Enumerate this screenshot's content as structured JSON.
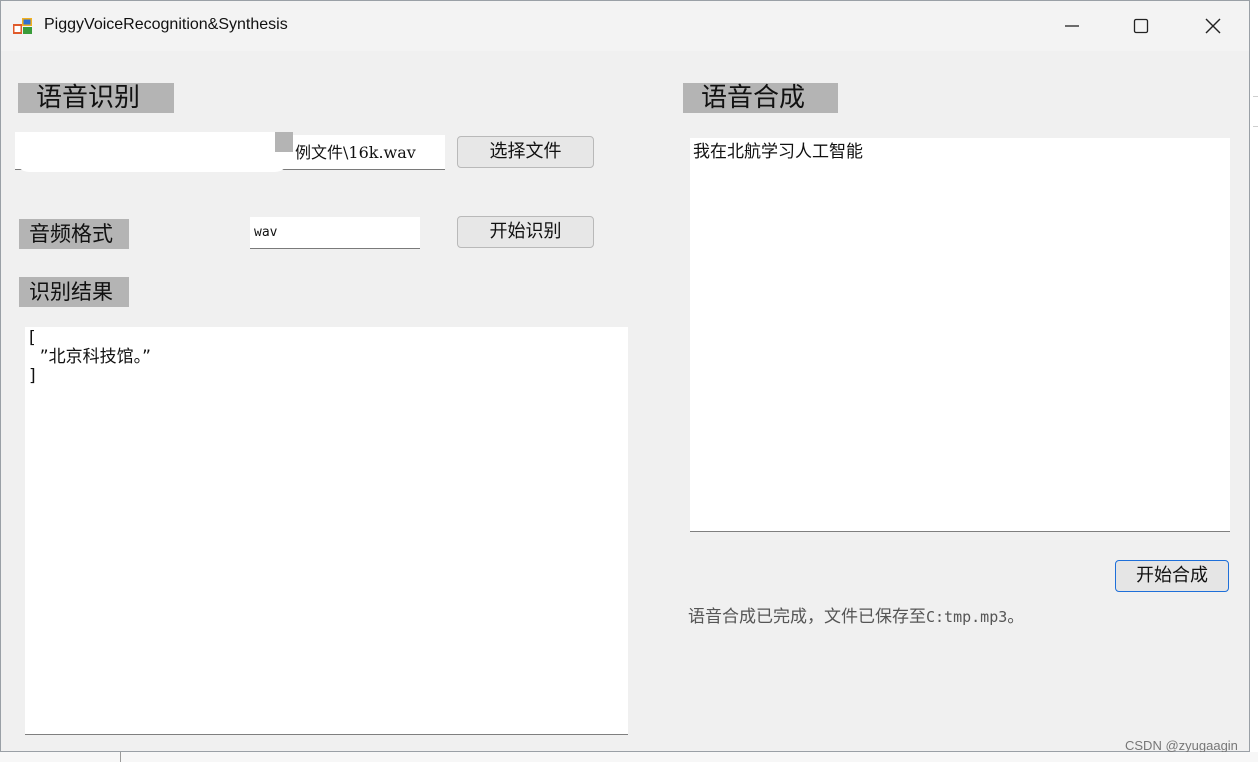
{
  "window": {
    "title": "PiggyVoiceRecognition&Synthesis",
    "controls": {
      "minimize_icon": "minimize-icon",
      "maximize_icon": "maximize-icon",
      "close_icon": "close-icon"
    }
  },
  "recognition": {
    "header": "语音识别",
    "file_path_value": "例文件\\16k.wav",
    "choose_file_button": "选择文件",
    "format_label": "音频格式",
    "format_value": "wav",
    "start_recognition_button": "开始识别",
    "result_label": "识别结果",
    "result_lines": [
      "[",
      "  ”北京科技馆。”",
      "]"
    ]
  },
  "synthesis": {
    "header": "语音合成",
    "input_text": "我在北航学习人工智能",
    "start_synthesis_button": "开始合成",
    "status_prefix": "语音合成已完成，文件已保存至",
    "status_path": "C:tmp.mp3",
    "status_suffix": "。"
  },
  "watermark": "CSDN @zyugaagin",
  "colors": {
    "window_bg": "#f0f0f0",
    "label_bg": "#b4b4b4",
    "focus_border": "#1e6fd9"
  }
}
